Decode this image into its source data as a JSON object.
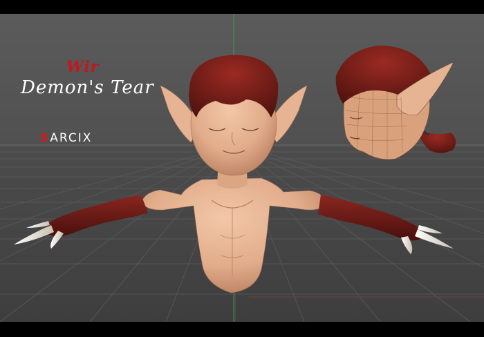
{
  "title": {
    "prefix": "Wir",
    "main": "Demon's Tear"
  },
  "signature": {
    "mark": "S",
    "text": "ARCIX"
  },
  "scene": {
    "subject_main": "bust-model",
    "subject_side": "head-wireframe-view",
    "background": "viewport-grid"
  },
  "colors": {
    "title_accent": "#c4161c",
    "title_text": "#ffffff",
    "skin": "#e7b594",
    "hair": "#7a1e18",
    "gloves": "#6a1a16",
    "claws": "#f1ece2",
    "viewport_bg": "#515151",
    "frame": "#000000"
  }
}
